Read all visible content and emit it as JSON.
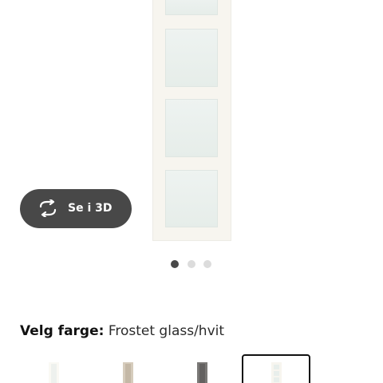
{
  "product_image": {
    "name": "product-image",
    "panes": 4
  },
  "view_3d": {
    "label": "Se i 3D",
    "icon": "rotate-3d-icon"
  },
  "carousel": {
    "total": 3,
    "active_index": 0
  },
  "color_selector": {
    "label": "Velg farge:",
    "value": "Frostet glass/hvit",
    "swatches": [
      {
        "name": "frosted-white",
        "color": "#f3f3ef",
        "frame": "#ffffff",
        "selected": false
      },
      {
        "name": "beige",
        "color": "#cbbfae",
        "frame": "#d8cdbd",
        "selected": false
      },
      {
        "name": "dark-grey",
        "color": "#6a6866",
        "frame": "#7d7b79",
        "selected": false
      },
      {
        "name": "frosted-glass-white",
        "color": "#eef1ef",
        "frame": "#f7f5ef",
        "selected": true
      }
    ]
  },
  "colors": {
    "button_bg": "#484848",
    "dot_active": "#484848",
    "dot_inactive": "#dcdcdc"
  }
}
